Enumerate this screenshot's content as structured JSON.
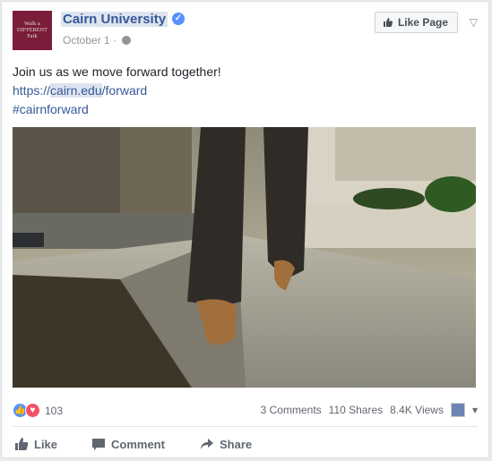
{
  "post": {
    "page_name": "Cairn University",
    "date": "October 1",
    "logo_lines": [
      "Walk a",
      "DIFFERENT",
      "Path"
    ],
    "like_page_label": "Like Page",
    "text_line1": "Join us as we move forward together!",
    "link_prefix": "https://",
    "link_domain": "cairn.edu",
    "link_path": "/forward",
    "hashtag": "#cairnforward"
  },
  "stats": {
    "reactions": "103",
    "comments": "3 Comments",
    "shares": "110 Shares",
    "views": "8.4K Views"
  },
  "actions": {
    "like": "Like",
    "comment": "Comment",
    "share": "Share"
  },
  "colors": {
    "link": "#365899",
    "brand": "#7a1d3a",
    "like_blue": "#5890ff",
    "love_red": "#f25268"
  }
}
